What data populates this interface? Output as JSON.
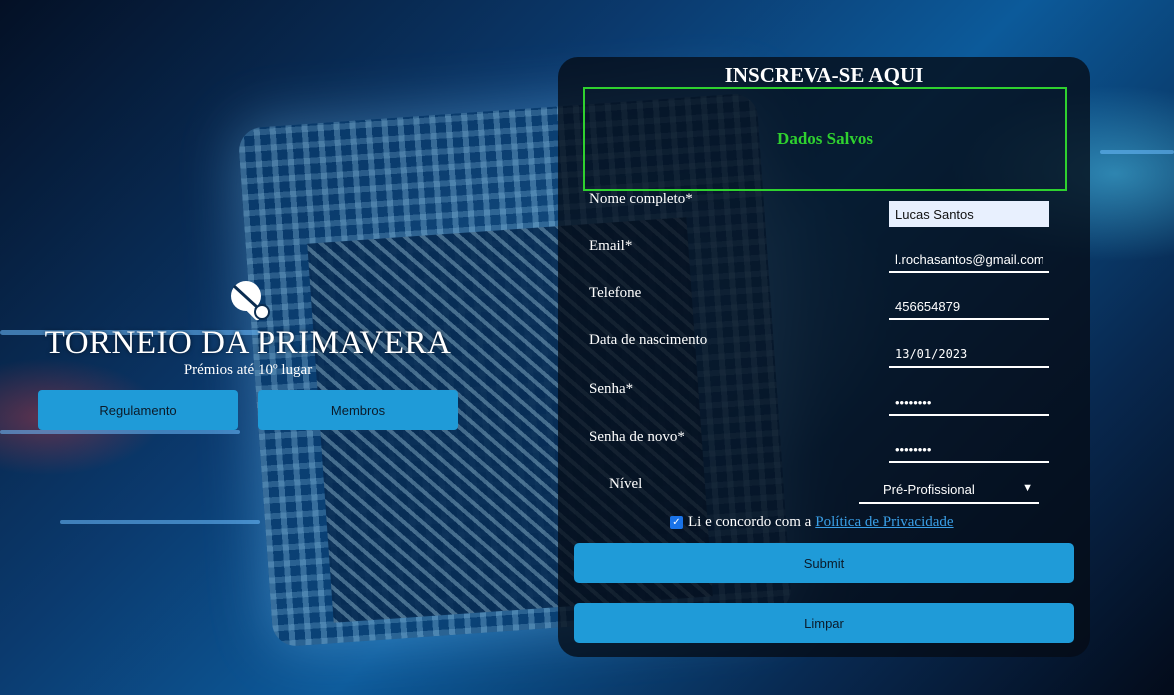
{
  "hero": {
    "title": "TORNEIO DA PRIMAVERA",
    "subtitle": "Prémios até 10º lugar",
    "logo_icon": "ping-pong-paddle-icon",
    "buttons": {
      "regulamento": "Regulamento",
      "membros": "Membros"
    }
  },
  "form": {
    "title": "INSCREVA-SE AQUI",
    "status_message": "Dados Salvos",
    "fields": {
      "nome": {
        "label": "Nome completo*",
        "value": "Lucas Santos"
      },
      "email": {
        "label": "Email*",
        "value": "l.rochasantos@gmail.com"
      },
      "telefone": {
        "label": "Telefone",
        "value": "456654879"
      },
      "nascimento": {
        "label": "Data de nascimento",
        "value": "13/01/2023"
      },
      "senha": {
        "label": "Senha*",
        "value": "••••••••"
      },
      "senha_novo": {
        "label": "Senha de novo*",
        "value": "••••••••"
      },
      "nivel": {
        "label": "Nível",
        "value": "Pré-Profissional"
      }
    },
    "consent": {
      "checked": true,
      "text": "Li e concordo com a",
      "link": "Política de Privacidade"
    },
    "submit_label": "Submit",
    "clear_label": "Limpar"
  },
  "colors": {
    "accent_button": "#1f9bd8",
    "success": "#2fd12f",
    "link": "#3aa0e8",
    "panel": "#050c16"
  }
}
